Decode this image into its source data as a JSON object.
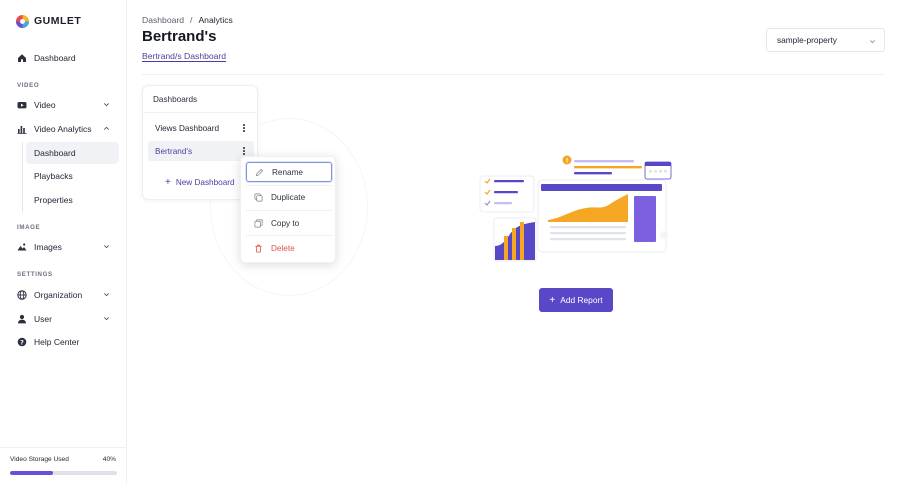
{
  "brand": {
    "name": "GUMLET",
    "accent": "#5847c7"
  },
  "sidebar": {
    "items": [
      {
        "label": "Dashboard",
        "icon": "home-icon"
      },
      {
        "label": "Video",
        "icon": "video-icon"
      },
      {
        "label": "Video Analytics",
        "icon": "bar-chart-icon"
      },
      {
        "label": "Images",
        "icon": "image-icon"
      },
      {
        "label": "Organization",
        "icon": "globe-icon"
      },
      {
        "label": "User",
        "icon": "user-icon"
      },
      {
        "label": "Help Center",
        "icon": "help-icon"
      }
    ],
    "sections": {
      "video": "VIDEO",
      "image": "IMAGE",
      "settings": "SETTINGS"
    },
    "analytics_sub": [
      {
        "label": "Dashboard"
      },
      {
        "label": "Playbacks"
      },
      {
        "label": "Properties"
      }
    ],
    "storage": {
      "label": "Video Storage Used",
      "percent_label": "40%",
      "percent": 40
    }
  },
  "header": {
    "breadcrumb": {
      "parent": "Dashboard",
      "separator": "/",
      "current": "Analytics"
    },
    "title": "Bertrand's",
    "subtitle": "Bertrand/s Dashboard",
    "property_select": "sample-property"
  },
  "dashboards": {
    "title": "Dashboards",
    "rows": [
      {
        "label": "Views Dashboard"
      },
      {
        "label": "Bertrand's"
      }
    ],
    "new_label": "New Dashboard"
  },
  "context_menu": {
    "items": [
      {
        "label": "Rename",
        "icon": "pencil-icon"
      },
      {
        "label": "Duplicate",
        "icon": "duplicate-icon"
      },
      {
        "label": "Copy to",
        "icon": "copy-icon"
      },
      {
        "label": "Delete",
        "icon": "trash-icon"
      }
    ]
  },
  "empty_state": {
    "button_label": "Add Report"
  }
}
